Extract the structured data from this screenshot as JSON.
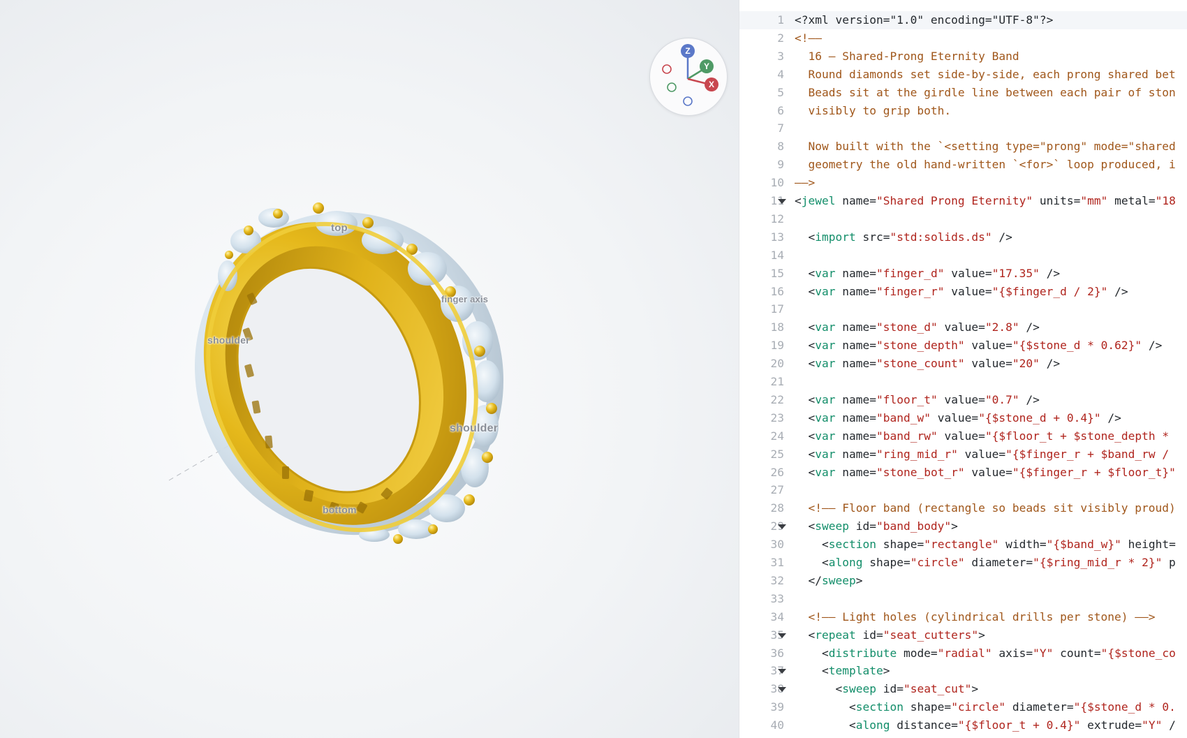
{
  "viewport": {
    "labels": {
      "top": "top",
      "finger_axis": "finger axis",
      "shoulder_left": "shoulder",
      "shoulder_right": "shoulder",
      "bottom": "bottom"
    },
    "gizmo": {
      "z": "Z",
      "y": "Y",
      "x": "X"
    },
    "colors": {
      "metal": "#e3b619",
      "stone": "#d6e4ee",
      "axis_z": "#5b78c8",
      "axis_y": "#4f9a66",
      "axis_x": "#c8474f"
    }
  },
  "editor": {
    "active_line": 1,
    "lines": [
      {
        "n": "1",
        "fold": false,
        "tokens": [
          [
            "p",
            "<?xml version=\"1.0\" encoding=\"UTF-8\"?>"
          ]
        ]
      },
      {
        "n": "2",
        "fold": false,
        "tokens": [
          [
            "c",
            "<!——"
          ]
        ]
      },
      {
        "n": "3",
        "fold": false,
        "tokens": [
          [
            "c",
            "  16 — Shared-Prong Eternity Band"
          ]
        ]
      },
      {
        "n": "4",
        "fold": false,
        "tokens": [
          [
            "c",
            "  Round diamonds set side-by-side, each prong shared bet"
          ]
        ]
      },
      {
        "n": "5",
        "fold": false,
        "tokens": [
          [
            "c",
            "  Beads sit at the girdle line between each pair of ston"
          ]
        ]
      },
      {
        "n": "6",
        "fold": false,
        "tokens": [
          [
            "c",
            "  visibly to grip both."
          ]
        ]
      },
      {
        "n": "7",
        "fold": false,
        "tokens": []
      },
      {
        "n": "8",
        "fold": false,
        "tokens": [
          [
            "c",
            "  Now built with the `<setting type=\"prong\" mode=\"shared"
          ]
        ]
      },
      {
        "n": "9",
        "fold": false,
        "tokens": [
          [
            "c",
            "  geometry the old hand-written `<for>` loop produced, i"
          ]
        ]
      },
      {
        "n": "10",
        "fold": false,
        "tokens": [
          [
            "c",
            "——>"
          ]
        ]
      },
      {
        "n": "11",
        "fold": true,
        "tokens": [
          [
            "p",
            "<"
          ],
          [
            "t",
            "jewel"
          ],
          [
            "a",
            " name="
          ],
          [
            "v",
            "\"Shared Prong Eternity\""
          ],
          [
            "a",
            " units="
          ],
          [
            "v",
            "\"mm\""
          ],
          [
            "a",
            " metal="
          ],
          [
            "v",
            "\"18"
          ]
        ]
      },
      {
        "n": "12",
        "fold": false,
        "tokens": []
      },
      {
        "n": "13",
        "fold": false,
        "tokens": [
          [
            "p",
            "  <"
          ],
          [
            "t",
            "import"
          ],
          [
            "a",
            " src="
          ],
          [
            "v",
            "\"std:solids.ds\""
          ],
          [
            "p",
            " />"
          ]
        ]
      },
      {
        "n": "14",
        "fold": false,
        "tokens": []
      },
      {
        "n": "15",
        "fold": false,
        "tokens": [
          [
            "p",
            "  <"
          ],
          [
            "t",
            "var"
          ],
          [
            "a",
            " name="
          ],
          [
            "v",
            "\"finger_d\""
          ],
          [
            "a",
            " value="
          ],
          [
            "v",
            "\"17.35\""
          ],
          [
            "p",
            " />"
          ]
        ]
      },
      {
        "n": "16",
        "fold": false,
        "tokens": [
          [
            "p",
            "  <"
          ],
          [
            "t",
            "var"
          ],
          [
            "a",
            " name="
          ],
          [
            "v",
            "\"finger_r\""
          ],
          [
            "a",
            " value="
          ],
          [
            "v",
            "\"{$finger_d / 2}\""
          ],
          [
            "p",
            " />"
          ]
        ]
      },
      {
        "n": "17",
        "fold": false,
        "tokens": []
      },
      {
        "n": "18",
        "fold": false,
        "tokens": [
          [
            "p",
            "  <"
          ],
          [
            "t",
            "var"
          ],
          [
            "a",
            " name="
          ],
          [
            "v",
            "\"stone_d\""
          ],
          [
            "a",
            " value="
          ],
          [
            "v",
            "\"2.8\""
          ],
          [
            "p",
            " />"
          ]
        ]
      },
      {
        "n": "19",
        "fold": false,
        "tokens": [
          [
            "p",
            "  <"
          ],
          [
            "t",
            "var"
          ],
          [
            "a",
            " name="
          ],
          [
            "v",
            "\"stone_depth\""
          ],
          [
            "a",
            " value="
          ],
          [
            "v",
            "\"{$stone_d * 0.62}\""
          ],
          [
            "p",
            " />"
          ]
        ]
      },
      {
        "n": "20",
        "fold": false,
        "tokens": [
          [
            "p",
            "  <"
          ],
          [
            "t",
            "var"
          ],
          [
            "a",
            " name="
          ],
          [
            "v",
            "\"stone_count\""
          ],
          [
            "a",
            " value="
          ],
          [
            "v",
            "\"20\""
          ],
          [
            "p",
            " />"
          ]
        ]
      },
      {
        "n": "21",
        "fold": false,
        "tokens": []
      },
      {
        "n": "22",
        "fold": false,
        "tokens": [
          [
            "p",
            "  <"
          ],
          [
            "t",
            "var"
          ],
          [
            "a",
            " name="
          ],
          [
            "v",
            "\"floor_t\""
          ],
          [
            "a",
            " value="
          ],
          [
            "v",
            "\"0.7\""
          ],
          [
            "p",
            " />"
          ]
        ]
      },
      {
        "n": "23",
        "fold": false,
        "tokens": [
          [
            "p",
            "  <"
          ],
          [
            "t",
            "var"
          ],
          [
            "a",
            " name="
          ],
          [
            "v",
            "\"band_w\""
          ],
          [
            "a",
            " value="
          ],
          [
            "v",
            "\"{$stone_d + 0.4}\""
          ],
          [
            "p",
            " />"
          ]
        ]
      },
      {
        "n": "24",
        "fold": false,
        "tokens": [
          [
            "p",
            "  <"
          ],
          [
            "t",
            "var"
          ],
          [
            "a",
            " name="
          ],
          [
            "v",
            "\"band_rw\""
          ],
          [
            "a",
            " value="
          ],
          [
            "v",
            "\"{$floor_t + $stone_depth *"
          ]
        ]
      },
      {
        "n": "25",
        "fold": false,
        "tokens": [
          [
            "p",
            "  <"
          ],
          [
            "t",
            "var"
          ],
          [
            "a",
            " name="
          ],
          [
            "v",
            "\"ring_mid_r\""
          ],
          [
            "a",
            " value="
          ],
          [
            "v",
            "\"{$finger_r + $band_rw /"
          ]
        ]
      },
      {
        "n": "26",
        "fold": false,
        "tokens": [
          [
            "p",
            "  <"
          ],
          [
            "t",
            "var"
          ],
          [
            "a",
            " name="
          ],
          [
            "v",
            "\"stone_bot_r\""
          ],
          [
            "a",
            " value="
          ],
          [
            "v",
            "\"{$finger_r + $floor_t}\""
          ]
        ]
      },
      {
        "n": "27",
        "fold": false,
        "tokens": []
      },
      {
        "n": "28",
        "fold": false,
        "tokens": [
          [
            "c",
            "  <!—— Floor band (rectangle so beads sit visibly proud)"
          ]
        ]
      },
      {
        "n": "29",
        "fold": true,
        "tokens": [
          [
            "p",
            "  <"
          ],
          [
            "t",
            "sweep"
          ],
          [
            "a",
            " id="
          ],
          [
            "v",
            "\"band_body\""
          ],
          [
            "p",
            ">"
          ]
        ]
      },
      {
        "n": "30",
        "fold": false,
        "tokens": [
          [
            "p",
            "    <"
          ],
          [
            "t",
            "section"
          ],
          [
            "a",
            " shape="
          ],
          [
            "v",
            "\"rectangle\""
          ],
          [
            "a",
            " width="
          ],
          [
            "v",
            "\"{$band_w}\""
          ],
          [
            "a",
            " height="
          ]
        ]
      },
      {
        "n": "31",
        "fold": false,
        "tokens": [
          [
            "p",
            "    <"
          ],
          [
            "t",
            "along"
          ],
          [
            "a",
            " shape="
          ],
          [
            "v",
            "\"circle\""
          ],
          [
            "a",
            " diameter="
          ],
          [
            "v",
            "\"{$ring_mid_r * 2}\""
          ],
          [
            "a",
            " p"
          ]
        ]
      },
      {
        "n": "32",
        "fold": false,
        "tokens": [
          [
            "p",
            "  </"
          ],
          [
            "t",
            "sweep"
          ],
          [
            "p",
            ">"
          ]
        ]
      },
      {
        "n": "33",
        "fold": false,
        "tokens": []
      },
      {
        "n": "34",
        "fold": false,
        "tokens": [
          [
            "c",
            "  <!—— Light holes (cylindrical drills per stone) ——>"
          ]
        ]
      },
      {
        "n": "35",
        "fold": true,
        "tokens": [
          [
            "p",
            "  <"
          ],
          [
            "t",
            "repeat"
          ],
          [
            "a",
            " id="
          ],
          [
            "v",
            "\"seat_cutters\""
          ],
          [
            "p",
            ">"
          ]
        ]
      },
      {
        "n": "36",
        "fold": false,
        "tokens": [
          [
            "p",
            "    <"
          ],
          [
            "t",
            "distribute"
          ],
          [
            "a",
            " mode="
          ],
          [
            "v",
            "\"radial\""
          ],
          [
            "a",
            " axis="
          ],
          [
            "v",
            "\"Y\""
          ],
          [
            "a",
            " count="
          ],
          [
            "v",
            "\"{$stone_co"
          ]
        ]
      },
      {
        "n": "37",
        "fold": true,
        "tokens": [
          [
            "p",
            "    <"
          ],
          [
            "t",
            "template"
          ],
          [
            "p",
            ">"
          ]
        ]
      },
      {
        "n": "38",
        "fold": true,
        "tokens": [
          [
            "p",
            "      <"
          ],
          [
            "t",
            "sweep"
          ],
          [
            "a",
            " id="
          ],
          [
            "v",
            "\"seat_cut\""
          ],
          [
            "p",
            ">"
          ]
        ]
      },
      {
        "n": "39",
        "fold": false,
        "tokens": [
          [
            "p",
            "        <"
          ],
          [
            "t",
            "section"
          ],
          [
            "a",
            " shape="
          ],
          [
            "v",
            "\"circle\""
          ],
          [
            "a",
            " diameter="
          ],
          [
            "v",
            "\"{$stone_d * 0."
          ]
        ]
      },
      {
        "n": "40",
        "fold": false,
        "tokens": [
          [
            "p",
            "        <"
          ],
          [
            "t",
            "along"
          ],
          [
            "a",
            " distance="
          ],
          [
            "v",
            "\"{$floor_t + 0.4}\""
          ],
          [
            "a",
            " extrude="
          ],
          [
            "v",
            "\"Y\""
          ],
          [
            "p",
            " /"
          ]
        ]
      }
    ]
  }
}
